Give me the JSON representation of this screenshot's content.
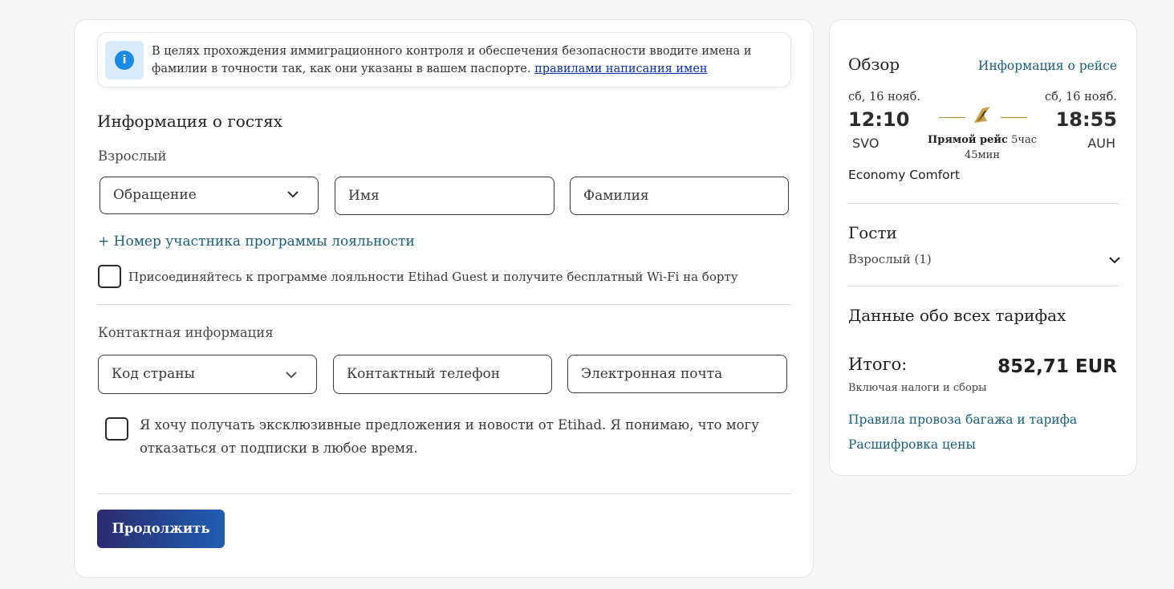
{
  "notice": {
    "icon": "info-icon",
    "text": "В целях прохождения иммиграционного контроля и обеспечения безопасности вводите имена и фамилии в точности так, как они указаны в вашем паспорте. ",
    "link": "правилами написания имен"
  },
  "guests_section": {
    "title": "Информация о гостях",
    "adult_label": "Взрослый",
    "title_select_placeholder": "Обращение",
    "first_name_placeholder": "Имя",
    "last_name_placeholder": "Фамилия",
    "loyalty_link": "+ Номер участника программы лояльности",
    "join_checkbox_label": "Присоединяйтесь к программе лояльности Etihad Guest и получите бесплатный Wi-Fi на борту"
  },
  "contact_section": {
    "title": "Контактная информация",
    "country_code_placeholder": "Код страны",
    "phone_placeholder": "Контактный телефон",
    "email_placeholder": "Электронная почта",
    "optin_label": "Я хочу получать эксклюзивные предложения и новости от Etihad. Я понимаю, что могу отказаться от подписки в любое время."
  },
  "continue_button": "Продолжить",
  "summary": {
    "title": "Обзор",
    "flight_info_link": "Информация о рейсе",
    "departure": {
      "date": "сб, 16 нояб.",
      "time": "12:10",
      "airport": "SVO"
    },
    "arrival": {
      "date": "сб, 16 нояб.",
      "time": "18:55",
      "airport": "AUH"
    },
    "direct_label": "Прямой рейс",
    "duration_hours": "5час",
    "duration_minutes": "45мин",
    "cabin": "Economy Comfort",
    "guests_title": "Гости",
    "guests_value": "Взрослый (1)",
    "fares_title": "Данные обо всех тарифах",
    "total_label": "Итого:",
    "total_value": "852,71 EUR",
    "tax_note": "Включая налоги и сборы",
    "baggage_link": "Правила провоза багажа и тарифа",
    "price_breakdown_link": "Расшифровка цены"
  },
  "colors": {
    "accent_link": "#1c5f7a",
    "button_gradient_start": "#2c2a6e",
    "button_gradient_end": "#1f5fb4",
    "info_icon": "#1b8ae6",
    "gold_line": "#b08d3a"
  }
}
